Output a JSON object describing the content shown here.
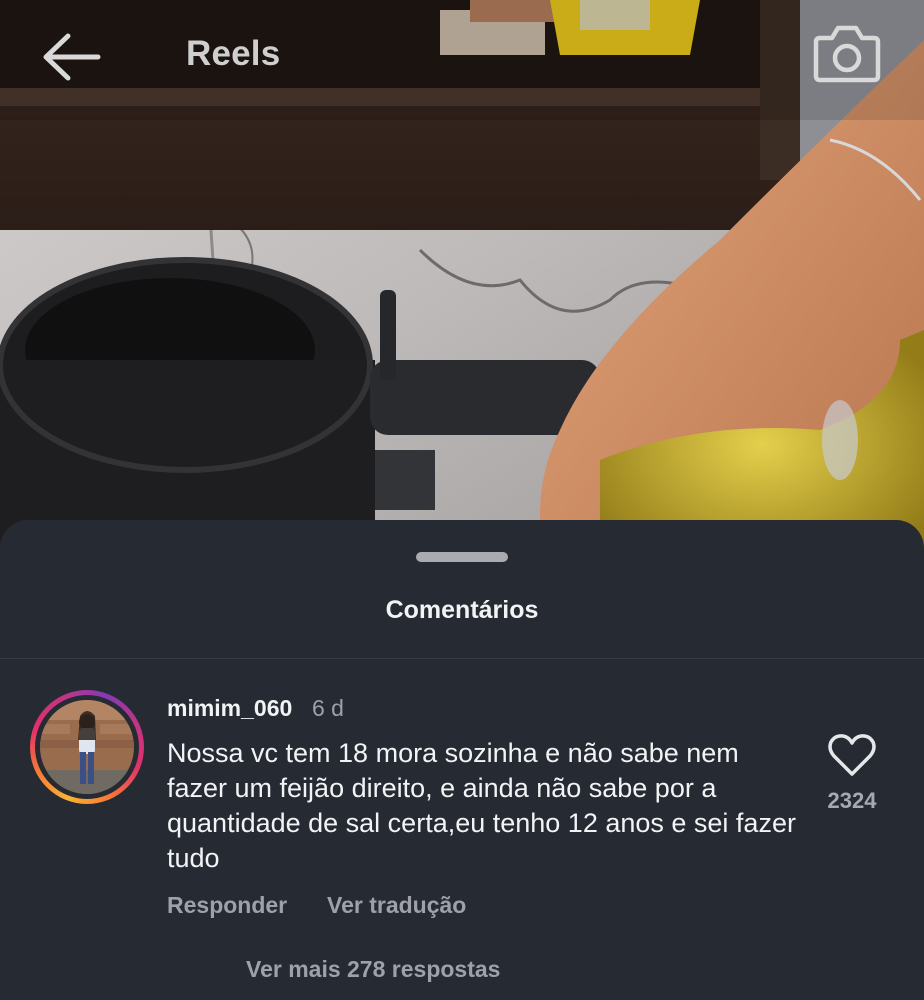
{
  "header": {
    "title": "Reels",
    "back_icon": "arrow-left-icon",
    "camera_icon": "camera-icon"
  },
  "comments_sheet": {
    "title": "Comentários",
    "comment": {
      "username": "mimim_060",
      "timestamp": "6 d",
      "text": "Nossa vc tem 18 mora sozinha e não sabe nem fazer um feijão direito, e ainda não sabe por a quantidade de sal certa,eu tenho 12 anos e sei fazer tudo",
      "like_icon": "heart-outline-icon",
      "like_count": "2324",
      "reply_label": "Responder",
      "translate_label": "Ver tradução",
      "more_replies_label": "Ver mais 278 respostas"
    }
  },
  "colors": {
    "sheet_background": "#262a33",
    "primary_text": "#f2f3f5",
    "secondary_text": "#9ea1a8"
  }
}
